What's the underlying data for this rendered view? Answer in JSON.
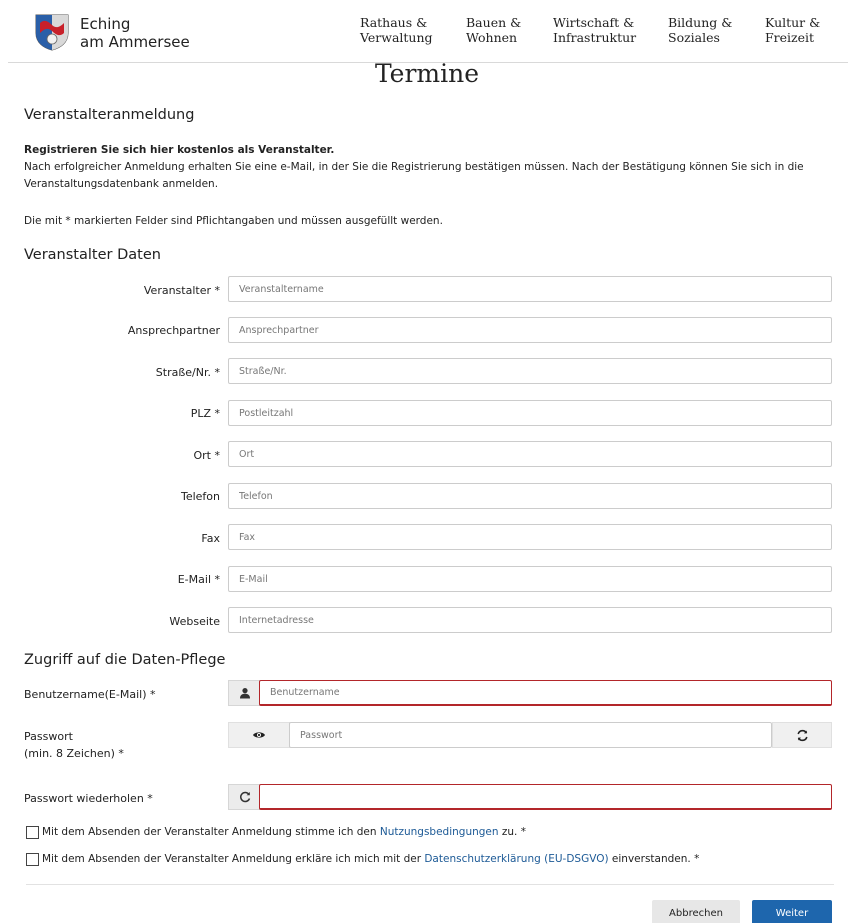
{
  "header": {
    "brand_line1": "Eching",
    "brand_line2": "am Ammersee",
    "nav": [
      {
        "line1": "Rathaus &",
        "line2": "Verwaltung"
      },
      {
        "line1": "Bauen &",
        "line2": "Wohnen"
      },
      {
        "line1": "Wirtschaft &",
        "line2": "Infrastruktur"
      },
      {
        "line1": "Bildung &",
        "line2": "Soziales"
      },
      {
        "line1": "Kultur &",
        "line2": "Freizeit"
      }
    ]
  },
  "page_title": "Termine",
  "section_registration": "Veranstalteranmeldung",
  "intro": {
    "bold": "Registrieren Sie sich hier kostenlos als Veranstalter.",
    "line2": "Nach erfolgreicher Anmeldung erhalten Sie eine e-Mail, in der Sie die Registrierung bestätigen müssen. Nach der Bestätigung können Sie sich in die",
    "line3": "Veranstaltungsdatenbank anmelden.",
    "required_note": "Die mit * markierten Felder sind Pflichtangaben und müssen ausgefüllt werden."
  },
  "section_organizer": "Veranstalter Daten",
  "fields": {
    "veranstalter": {
      "label": "Veranstalter *",
      "placeholder": "Veranstaltername"
    },
    "ansprechpartner": {
      "label": "Ansprechpartner",
      "placeholder": "Ansprechpartner"
    },
    "strasse": {
      "label": "Straße/Nr. *",
      "placeholder": "Straße/Nr."
    },
    "plz": {
      "label": "PLZ *",
      "placeholder": "Postleitzahl"
    },
    "ort": {
      "label": "Ort *",
      "placeholder": "Ort"
    },
    "telefon": {
      "label": "Telefon",
      "placeholder": "Telefon"
    },
    "fax": {
      "label": "Fax",
      "placeholder": "Fax"
    },
    "email": {
      "label": "E-Mail *",
      "placeholder": "E-Mail"
    },
    "webseite": {
      "label": "Webseite",
      "placeholder": "Internetadresse"
    }
  },
  "section_access": "Zugriff auf die Daten-Pflege",
  "access": {
    "username": {
      "label": "Benutzername(E-Mail) *",
      "placeholder": "Benutzername"
    },
    "password": {
      "label_line1": "Passwort",
      "label_line2": "(min. 8 Zeichen) *",
      "placeholder": "Passwort"
    },
    "password_repeat": {
      "label": "Passwort wiederholen *",
      "placeholder": ""
    }
  },
  "consent": {
    "terms_pre": "Mit dem Absenden der Veranstalter Anmeldung stimme ich den ",
    "terms_link": "Nutzungsbedingungen",
    "terms_post": " zu. *",
    "privacy_pre": "Mit dem Absenden der Veranstalter Anmeldung erkläre ich mich mit der ",
    "privacy_link": "Datenschutzerklärung (EU-DSGVO)",
    "privacy_post": " einverstanden. *"
  },
  "buttons": {
    "cancel": "Abbrechen",
    "next": "Weiter"
  },
  "colors": {
    "accent": "#1e66ad",
    "error_border": "#b3262a",
    "link": "#1d5a96"
  }
}
